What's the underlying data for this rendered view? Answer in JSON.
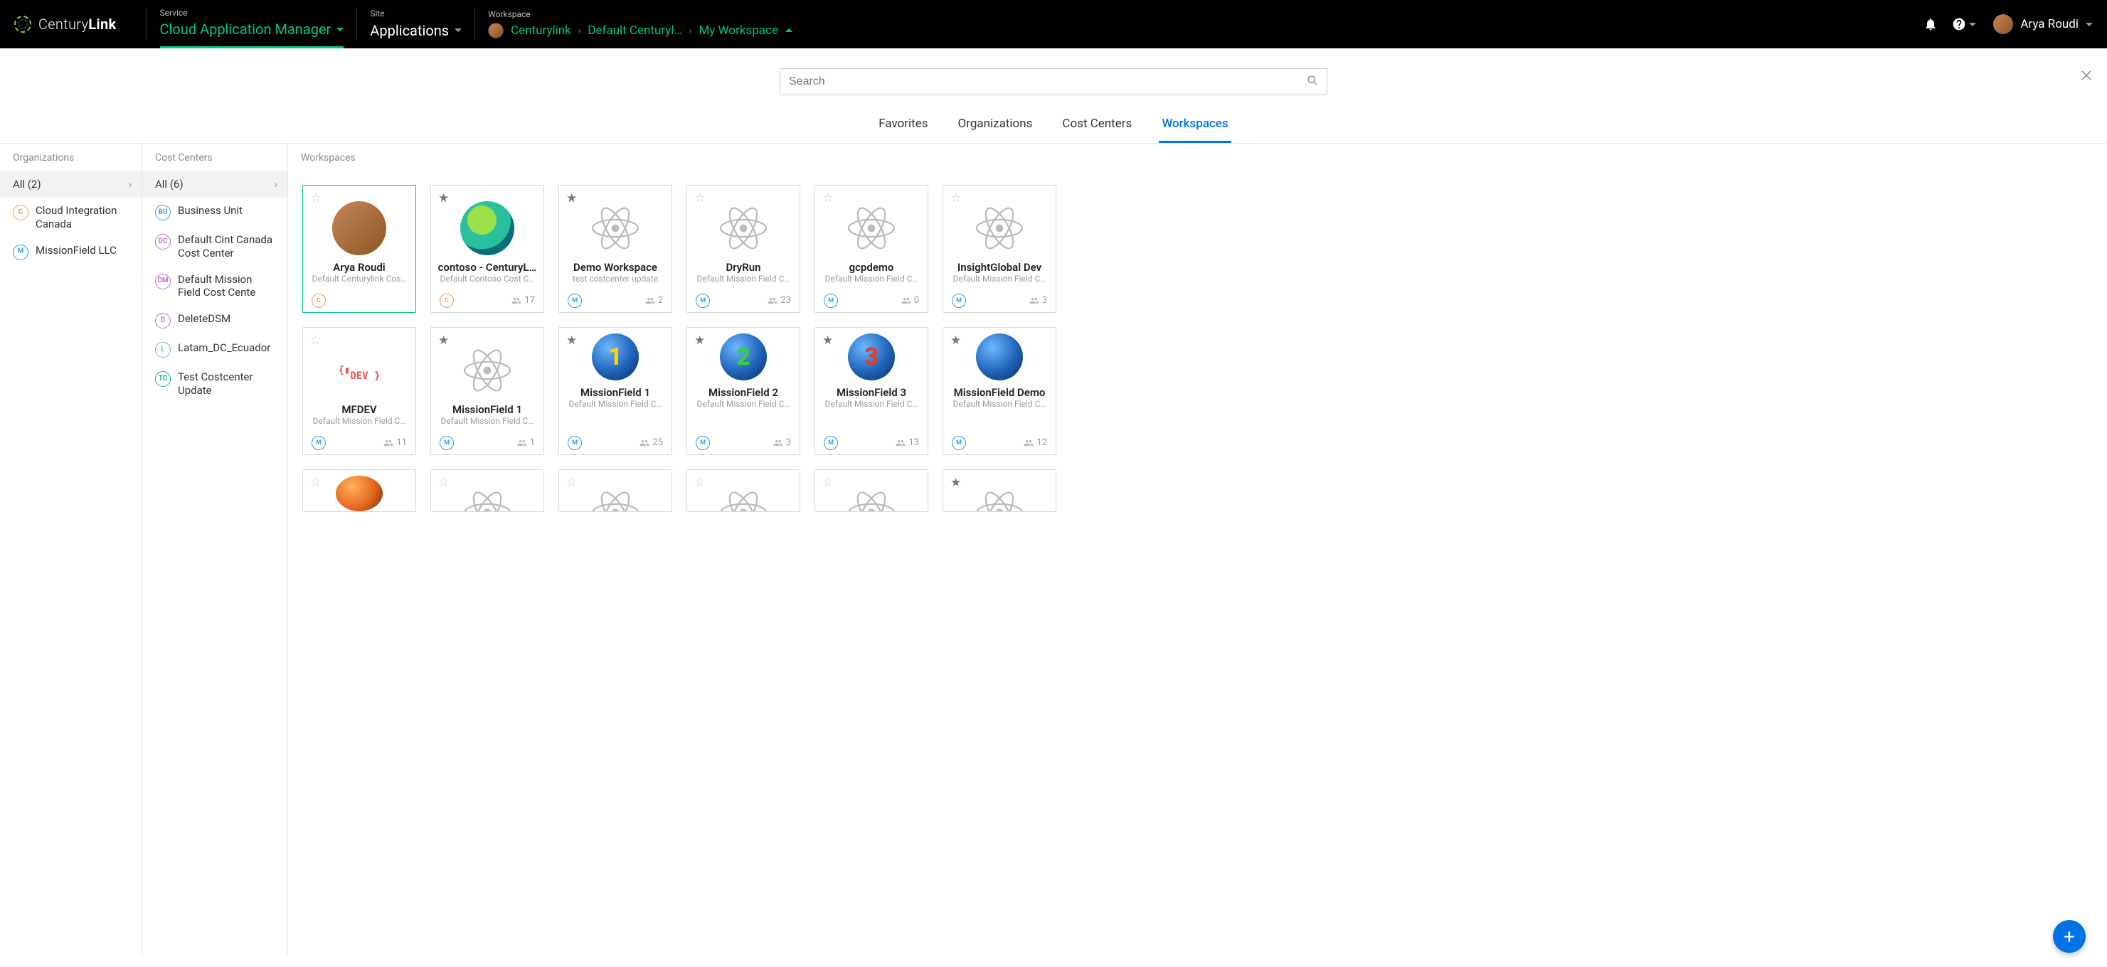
{
  "brand": {
    "part1": "Century",
    "part2": "Link"
  },
  "topbar": {
    "service_label": "Service",
    "service_value": "Cloud Application Manager",
    "site_label": "Site",
    "site_value": "Applications",
    "workspace_label": "Workspace",
    "breadcrumb": {
      "org": "Centurylink",
      "cc": "Default Centuryl…",
      "ws": "My Workspace"
    },
    "user_name": "Arya Roudi"
  },
  "search": {
    "placeholder": "Search"
  },
  "tabs": {
    "favorites": "Favorites",
    "organizations": "Organizations",
    "cost_centers": "Cost Centers",
    "workspaces": "Workspaces"
  },
  "col_heads": {
    "orgs": "Organizations",
    "ccs": "Cost Centers",
    "wss": "Workspaces"
  },
  "orgs": {
    "all": "All (2)",
    "items": [
      {
        "badge": "C",
        "cls": "b-c",
        "name": "Cloud Integration Canada"
      },
      {
        "badge": "M",
        "cls": "b-m",
        "name": "MissionField LLC"
      }
    ]
  },
  "ccs": {
    "all": "All (6)",
    "items": [
      {
        "badge": "BU",
        "cls": "b-bu",
        "name": "Business Unit"
      },
      {
        "badge": "DC",
        "cls": "b-dc",
        "name": "Default Cint Canada Cost Center"
      },
      {
        "badge": "DM",
        "cls": "b-dm",
        "name": "Default Mission Field Cost Cente"
      },
      {
        "badge": "D",
        "cls": "b-d",
        "name": "DeleteDSM"
      },
      {
        "badge": "L",
        "cls": "b-l",
        "name": "Latam_DC_Ecuador"
      },
      {
        "badge": "TC",
        "cls": "b-tc",
        "name": "Test Costcenter Update"
      }
    ]
  },
  "cards": [
    {
      "title": "Arya Roudi",
      "sub": "Default Centurylink Cos…",
      "star": "empty",
      "thumb": "avatar",
      "badge": "C",
      "badge_cls": "b-c",
      "members": "",
      "sel": true
    },
    {
      "title": "contoso - CenturyL…",
      "sub": "Default Contoso Cost C…",
      "star": "fill",
      "thumb": "logo-c",
      "badge": "C",
      "badge_cls": "b-c",
      "members": "17",
      "sel": false
    },
    {
      "title": "Demo Workspace",
      "sub": "test costcenter update",
      "star": "fill",
      "thumb": "atom",
      "badge": "M",
      "badge_cls": "b-m",
      "members": "2",
      "sel": false
    },
    {
      "title": "DryRun",
      "sub": "Default Mission Field C…",
      "star": "empty",
      "thumb": "atom",
      "badge": "M",
      "badge_cls": "b-m",
      "members": "23",
      "sel": false
    },
    {
      "title": "gcpdemo",
      "sub": "Default Mission Field C…",
      "star": "empty",
      "thumb": "atom",
      "badge": "M",
      "badge_cls": "b-m",
      "members": "0",
      "sel": false
    },
    {
      "title": "InsightGlobal Dev",
      "sub": "Default Mission Field C…",
      "star": "empty",
      "thumb": "atom",
      "badge": "M",
      "badge_cls": "b-m",
      "members": "3",
      "sel": false
    },
    {
      "title": "MFDEV",
      "sub": "Default Mission Field C…",
      "star": "empty",
      "thumb": "mfdev",
      "badge": "M",
      "badge_cls": "b-m",
      "members": "11",
      "sel": false
    },
    {
      "title": "MissionField 1",
      "sub": "Default Mission Field C…",
      "star": "fill",
      "thumb": "atom",
      "badge": "M",
      "badge_cls": "b-m",
      "members": "1",
      "sel": false
    },
    {
      "title": "MissionField 1",
      "sub": "Default Mission Field C…",
      "star": "fill",
      "thumb": "globe-1",
      "badge": "M",
      "badge_cls": "b-m",
      "members": "25",
      "sel": false
    },
    {
      "title": "MissionField 2",
      "sub": "Default Mission Field C…",
      "star": "fill",
      "thumb": "globe-2",
      "badge": "M",
      "badge_cls": "b-m",
      "members": "3",
      "sel": false
    },
    {
      "title": "MissionField 3",
      "sub": "Default Mission Field C…",
      "star": "fill",
      "thumb": "globe-3",
      "badge": "M",
      "badge_cls": "b-m",
      "members": "13",
      "sel": false
    },
    {
      "title": "MissionField Demo",
      "sub": "Default Mission Field C…",
      "star": "fill",
      "thumb": "globe",
      "badge": "M",
      "badge_cls": "b-m",
      "members": "12",
      "sel": false
    },
    {
      "title": "",
      "sub": "",
      "star": "empty",
      "thumb": "globe-half",
      "badge": "",
      "badge_cls": "",
      "members": "",
      "sel": false,
      "partial": true
    },
    {
      "title": "",
      "sub": "",
      "star": "empty",
      "thumb": "atom",
      "badge": "",
      "badge_cls": "",
      "members": "",
      "sel": false,
      "partial": true
    },
    {
      "title": "",
      "sub": "",
      "star": "empty",
      "thumb": "atom",
      "badge": "",
      "badge_cls": "",
      "members": "",
      "sel": false,
      "partial": true
    },
    {
      "title": "",
      "sub": "",
      "star": "empty",
      "thumb": "atom",
      "badge": "",
      "badge_cls": "",
      "members": "",
      "sel": false,
      "partial": true
    },
    {
      "title": "",
      "sub": "",
      "star": "empty",
      "thumb": "atom",
      "badge": "",
      "badge_cls": "",
      "members": "",
      "sel": false,
      "partial": true
    },
    {
      "title": "",
      "sub": "",
      "star": "fill",
      "thumb": "atom",
      "badge": "",
      "badge_cls": "",
      "members": "",
      "sel": false,
      "partial": true
    }
  ]
}
